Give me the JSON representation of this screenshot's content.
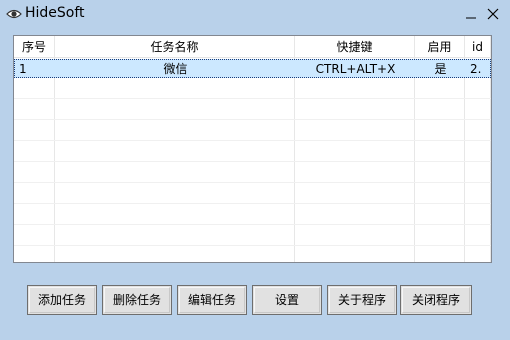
{
  "window": {
    "title": "HideSoft"
  },
  "table": {
    "columns": [
      "序号",
      "任务名称",
      "快捷键",
      "启用",
      "id"
    ],
    "rows": [
      {
        "index": "1",
        "name": "微信",
        "hotkey": "CTRL+ALT+X",
        "enabled": "是",
        "id": "2."
      }
    ]
  },
  "buttons": {
    "add": "添加任务",
    "delete": "删除任务",
    "edit": "编辑任务",
    "settings": "设置",
    "about": "关于程序",
    "close": "关闭程序"
  },
  "colors": {
    "window_bg": "#b9d1ea",
    "selection": "#cce8ff"
  }
}
